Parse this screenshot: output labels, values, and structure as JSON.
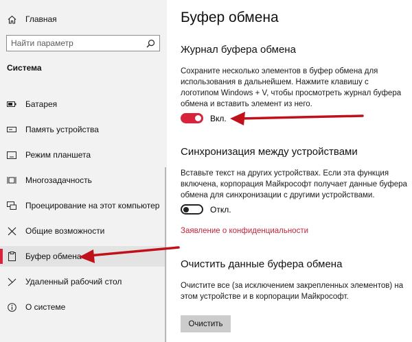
{
  "sidebar": {
    "home_label": "Главная",
    "search_placeholder": "Найти параметр",
    "section_label": "Система",
    "items": [
      {
        "label": "Батарея",
        "icon": "battery-icon"
      },
      {
        "label": "Память устройства",
        "icon": "storage-icon"
      },
      {
        "label": "Режим планшета",
        "icon": "tablet-mode-icon"
      },
      {
        "label": "Многозадачность",
        "icon": "multitasking-icon"
      },
      {
        "label": "Проецирование на этот компьютер",
        "icon": "projecting-icon"
      },
      {
        "label": "Общие возможности",
        "icon": "shared-experiences-icon"
      },
      {
        "label": "Буфер обмена",
        "icon": "clipboard-icon",
        "active": true
      },
      {
        "label": "Удаленный рабочий стол",
        "icon": "remote-desktop-icon"
      },
      {
        "label": "О системе",
        "icon": "info-icon"
      }
    ]
  },
  "main": {
    "title": "Буфер обмена",
    "history": {
      "heading": "Журнал буфера обмена",
      "description": "Сохраните несколько элементов в буфер обмена для использования в дальнейшем. Нажмите клавишу с логотипом Windows + V, чтобы просмотреть журнал буфера обмена и вставить элемент из него.",
      "toggle_state": "Вкл."
    },
    "sync": {
      "heading": "Синхронизация между устройствами",
      "description": "Вставьте текст на других устройствах. Если эта функция включена, корпорация Майкрософт получает данные буфера обмена для синхронизации с другими устройствами.",
      "toggle_state": "Откл.",
      "privacy_link": "Заявление о конфиденциальности"
    },
    "clear": {
      "heading": "Очистить данные буфера обмена",
      "description": "Очистите все (за исключением закрепленных элементов) на этом устройстве и в корпорации Майкрософт.",
      "button_label": "Очистить"
    }
  },
  "colors": {
    "accent": "#d7233b",
    "sidebar_bg": "#f2f2f2",
    "button_bg": "#cccccc",
    "arrow": "#c0101a"
  }
}
